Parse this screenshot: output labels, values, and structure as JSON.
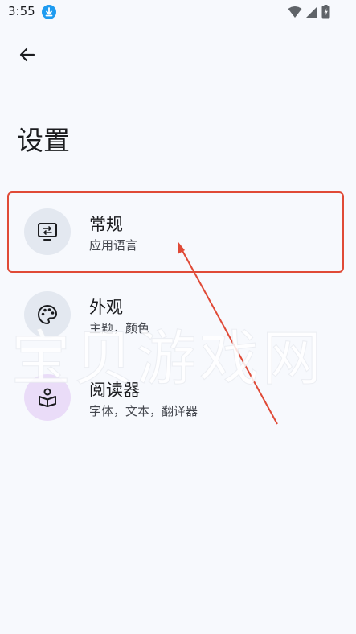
{
  "status_bar": {
    "time": "3:55",
    "icons": [
      "download-icon",
      "wifi-icon",
      "signal-icon",
      "battery-icon"
    ]
  },
  "header": {
    "back_icon": "arrow-left-icon",
    "title": "设置"
  },
  "settings": [
    {
      "title": "常规",
      "subtitle": "应用语言",
      "icon": "monitor-icon",
      "icon_bg": "#e3e8f0"
    },
    {
      "title": "外观",
      "subtitle": "主题，颜色",
      "icon": "palette-icon",
      "icon_bg": "#e3e8f0"
    },
    {
      "title": "阅读器",
      "subtitle": "字体，文本，翻译器",
      "icon": "reader-icon",
      "icon_bg": "#eadcf8"
    }
  ],
  "annotation": {
    "color": "#e04a37"
  },
  "watermark": "宝贝游戏网"
}
